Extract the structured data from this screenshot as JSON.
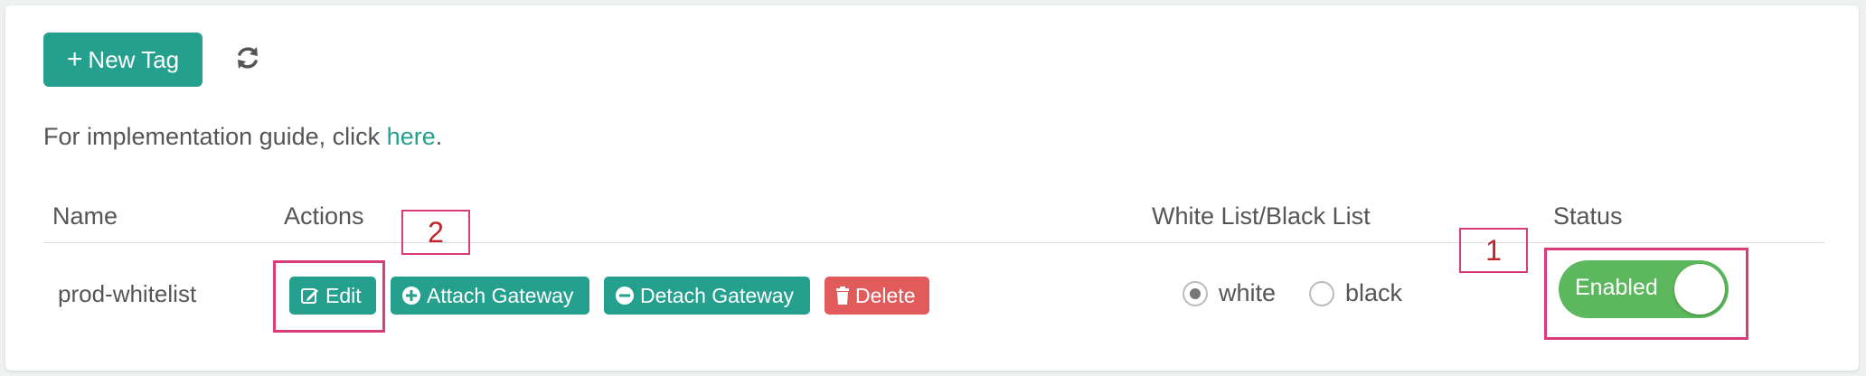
{
  "toolbar": {
    "new_tag_label": "New Tag",
    "new_tag_icon": "plus-icon",
    "refresh_icon": "refresh-icon"
  },
  "guide": {
    "text_before": "For implementation guide, click ",
    "link_text": "here",
    "text_after": "."
  },
  "table": {
    "headers": [
      "Name",
      "Actions",
      "White List/Black List",
      "Status"
    ],
    "rows": [
      {
        "name": "prod-whitelist",
        "actions": [
          {
            "label": "Edit",
            "icon": "edit-icon",
            "color": "#26a08e"
          },
          {
            "label": "Attach Gateway",
            "icon": "plus-circle-icon",
            "color": "#26a08e"
          },
          {
            "label": "Detach Gateway",
            "icon": "minus-circle-icon",
            "color": "#26a08e"
          },
          {
            "label": "Delete",
            "icon": "trash-icon",
            "color": "#e25b5b"
          }
        ],
        "list_options": [
          "white",
          "black"
        ],
        "list_selected": "white",
        "status": "Enabled"
      }
    ]
  },
  "annotations": [
    "1",
    "2"
  ],
  "colors": {
    "accent": "#26a08e",
    "danger": "#e25b5b",
    "toggle_on": "#5cb85c",
    "annotation": "#d83c79"
  }
}
